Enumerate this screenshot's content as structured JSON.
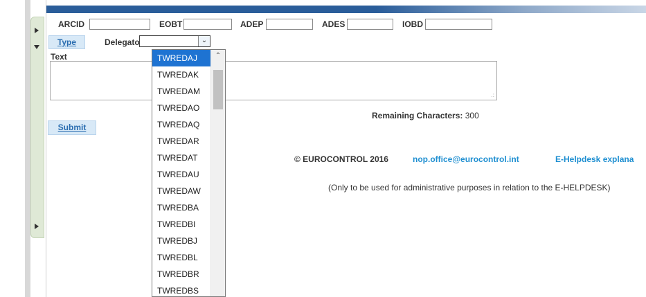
{
  "form": {
    "arcid_label": "ARCID",
    "eobt_label": "EOBT",
    "adep_label": "ADEP",
    "ades_label": "ADES",
    "iobd_label": "IOBD",
    "arcid_value": "",
    "eobt_value": "",
    "adep_value": "",
    "ades_value": "",
    "iobd_value": "",
    "type_button": "Type",
    "delegator_label": "Delegator",
    "delegator_value": "",
    "text_label": "Text",
    "text_value": "",
    "remaining_label": "Remaining Characters:",
    "remaining_value": "300",
    "submit_button": "Submit"
  },
  "delegator_dropdown": {
    "selected": "TWREDAJ",
    "options": [
      "TWREDAJ",
      "TWREDAK",
      "TWREDAM",
      "TWREDAO",
      "TWREDAQ",
      "TWREDAR",
      "TWREDAT",
      "TWREDAU",
      "TWREDAW",
      "TWREDBA",
      "TWREDBI",
      "TWREDBJ",
      "TWREDBL",
      "TWREDBR",
      "TWREDBS"
    ]
  },
  "footer": {
    "copyright": "© EUROCONTROL 2016",
    "email": "nop.office@eurocontrol.int",
    "helpdesk_link": "E-Helpdesk explana",
    "note": "(Only to be used for administrative purposes in relation to the E-HELPDESK)"
  },
  "icons": {
    "side_toggle_top": "triangle-right-icon",
    "side_toggle_mid": "triangle-down-icon",
    "side_toggle_bottom": "triangle-right-icon",
    "select_arrow": "chevron-down-icon",
    "scroll_up": "chevron-up-icon"
  },
  "colors": {
    "header_bar": "#2a5d9a",
    "link": "#1f8fd1",
    "selected_option": "#1e73d2",
    "button_bg": "#d8e9f7",
    "side_panel": "#dfe9d6"
  }
}
